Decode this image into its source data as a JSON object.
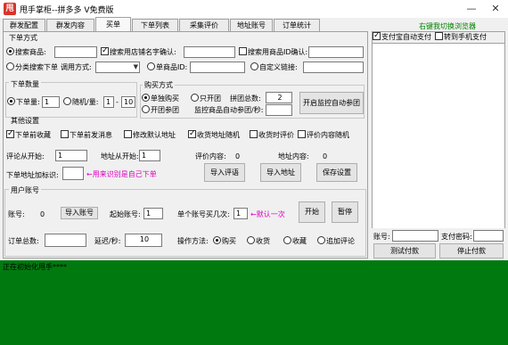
{
  "app": {
    "icon_glyph": "甩",
    "title": "甩手掌柜--拼多多 V免费版",
    "minimize": "—",
    "close": "✕"
  },
  "tabs": [
    "群发配置",
    "群发内容",
    "买单",
    "下单列表",
    "采集评价",
    "地址账号",
    "订单统计"
  ],
  "right_hint": "右键我切换浏览器",
  "order_method": {
    "title": "下单方式",
    "search_goods": "搜索商品:",
    "search_goods_shop": "搜索用店铺名字确认:",
    "search_goods_id": "搜索用商品ID确认:",
    "category_search": "分类搜索下单",
    "call_method": "调用方式:",
    "single_id": "单商品ID:",
    "custom_link": "自定义链接:"
  },
  "order_qty": {
    "title": "下单数量",
    "fixed_qty": "下单量:",
    "fixed_value": "1",
    "random_qty": "随机/量:",
    "random_min": "1",
    "random_sep": "-",
    "random_max": "10"
  },
  "buy_method": {
    "title": "购买方式",
    "single_buy": "单独购买",
    "group_only": "只开团",
    "join_group": "开团参团",
    "group_total_label": "拼团总数:",
    "group_total_value": "2",
    "monitor_label": "监控商品自动参团/秒:",
    "monitor_button": "开启监控自动参团"
  },
  "other": {
    "title": "其他设置",
    "collect_before": "下单前收藏",
    "send_msg_before": "下单前发消息",
    "modify_default_addr": "修改默认地址",
    "random_ship_addr": "收货地址随机",
    "review_on_receive": "收货时评价",
    "random_review": "评价内容随机",
    "review_start_label": "评论从开始:",
    "review_start_value": "1",
    "addr_start_label": "地址从开始:",
    "addr_start_value": "1",
    "review_content_label": "评价内容:",
    "review_content_value": "0",
    "addr_content_label": "地址内容:",
    "addr_content_value": "0",
    "order_addr_mark": "下单地址加标识:",
    "mark_hint": "←用来识别是自己下单",
    "import_review": "导入评语",
    "import_addr": "导入地址",
    "save_settings": "保存设置"
  },
  "user_account": {
    "title": "用户账号",
    "account_label": "账号:",
    "account_value": "0",
    "import_account": "导入账号",
    "start_account_label": "起始账号:",
    "start_account_value": "1",
    "single_buy_times_label": "单个账号买几次:",
    "single_buy_times_value": "1",
    "default_once_hint": "←默认一次",
    "start": "开始",
    "pause": "暂停",
    "total_orders_label": "订单总数:",
    "delay_label": "延迟/秒:",
    "delay_value": "10",
    "op_method_label": "操作方法:",
    "op_buy": "购买",
    "op_receive": "收货",
    "op_collect": "收藏",
    "op_add_review": "追加评论"
  },
  "right_panel": {
    "alipay_auto": "支付宝自动支付",
    "to_mobile": "转到手机支付",
    "account_label": "账号:",
    "pay_password_label": "支付密码:",
    "test_pay": "测试付款",
    "stop_pay": "停止付款"
  },
  "status": {
    "text": "正在初始化甩手****"
  },
  "colors": {
    "status_green": "#007a0f",
    "hint_magenta": "#e000c0",
    "hint_green": "#008000"
  }
}
